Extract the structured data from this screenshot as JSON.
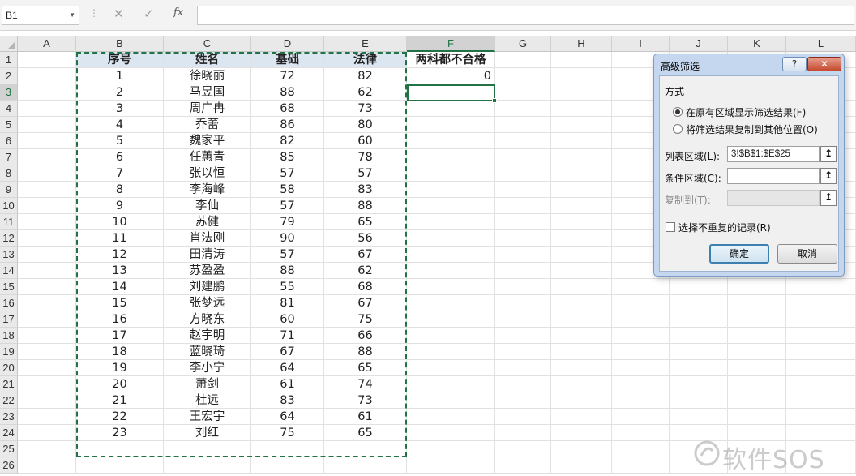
{
  "formula_bar": {
    "name_box": "B1",
    "formula": "",
    "fx_label": "fx"
  },
  "grid": {
    "columns": [
      "A",
      "B",
      "C",
      "D",
      "E",
      "F",
      "G",
      "H",
      "I",
      "J",
      "K",
      "L"
    ],
    "active_column": "F",
    "active_row": "3",
    "header_row": [
      "序号",
      "姓名",
      "基础",
      "法律"
    ],
    "rows": [
      [
        "1",
        "徐晓丽",
        "72",
        "82"
      ],
      [
        "2",
        "马昱国",
        "88",
        "62"
      ],
      [
        "3",
        "周广冉",
        "68",
        "73"
      ],
      [
        "4",
        "乔蕾",
        "86",
        "80"
      ],
      [
        "5",
        "魏家平",
        "82",
        "60"
      ],
      [
        "6",
        "任蕙青",
        "85",
        "78"
      ],
      [
        "7",
        "张以恒",
        "57",
        "57"
      ],
      [
        "8",
        "李海峰",
        "58",
        "83"
      ],
      [
        "9",
        "李仙",
        "57",
        "88"
      ],
      [
        "10",
        "苏健",
        "79",
        "65"
      ],
      [
        "11",
        "肖法刚",
        "90",
        "56"
      ],
      [
        "12",
        "田清涛",
        "57",
        "67"
      ],
      [
        "13",
        "苏盈盈",
        "88",
        "62"
      ],
      [
        "14",
        "刘建鹏",
        "55",
        "68"
      ],
      [
        "15",
        "张梦远",
        "81",
        "67"
      ],
      [
        "16",
        "方晓东",
        "60",
        "75"
      ],
      [
        "17",
        "赵宇明",
        "71",
        "66"
      ],
      [
        "18",
        "蓝晓琦",
        "67",
        "88"
      ],
      [
        "19",
        "李小宁",
        "64",
        "65"
      ],
      [
        "20",
        "萧剑",
        "61",
        "74"
      ],
      [
        "21",
        "杜远",
        "83",
        "73"
      ],
      [
        "22",
        "王宏宇",
        "64",
        "61"
      ],
      [
        "23",
        "刘红",
        "75",
        "65"
      ]
    ],
    "criteria_header": "两科都不合格",
    "criteria_value": "0"
  },
  "dialog": {
    "title": "高级筛选",
    "help_label": "?",
    "close_label": "✕",
    "group_label": "方式",
    "option_in_place": "在原有区域显示筛选结果(F)",
    "option_copy": "将筛选结果复制到其他位置(O)",
    "list_range_label": "列表区域(L):",
    "list_range_value": "3!$B$1:$E$25",
    "criteria_range_label": "条件区域(C):",
    "criteria_range_value": "",
    "copy_to_label": "复制到(T):",
    "copy_to_value": "",
    "unique_label": "选择不重复的记录(R)",
    "ok_label": "确定",
    "cancel_label": "取消",
    "collapse_icon_glyph": "↥"
  },
  "watermark": {
    "text": "软件SOS"
  }
}
